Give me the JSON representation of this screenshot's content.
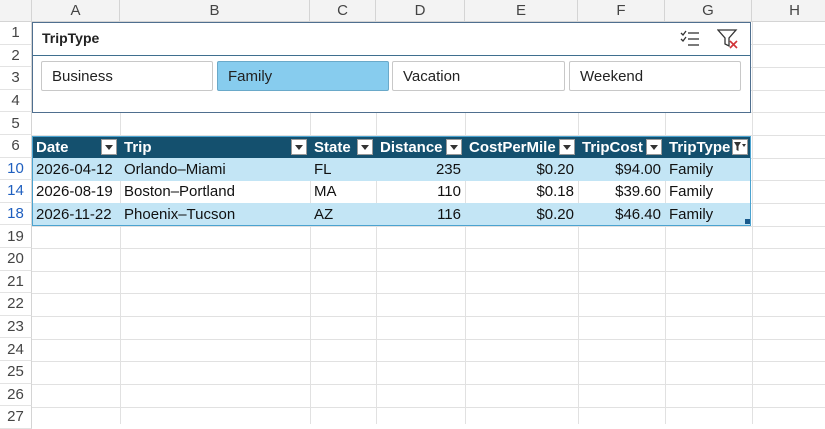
{
  "columns": [
    "A",
    "B",
    "C",
    "D",
    "E",
    "F",
    "G",
    "H"
  ],
  "rows": [
    "1",
    "2",
    "3",
    "4",
    "5",
    "6",
    "10",
    "14",
    "18",
    "19",
    "20",
    "21",
    "22",
    "23",
    "24",
    "25",
    "26",
    "27"
  ],
  "filtered_rows": [
    "10",
    "14",
    "18"
  ],
  "slicer": {
    "title": "TripType",
    "icons": [
      "multi-select-icon",
      "clear-filter-icon"
    ],
    "buttons": [
      {
        "label": "Business",
        "selected": false
      },
      {
        "label": "Family",
        "selected": true
      },
      {
        "label": "Vacation",
        "selected": false
      },
      {
        "label": "Weekend",
        "selected": false
      }
    ]
  },
  "table": {
    "headers": [
      "Date",
      "Trip",
      "State",
      "Distance",
      "CostPerMile",
      "TripCost",
      "TripType"
    ],
    "filtered_column": "TripType",
    "rows": [
      [
        "2026-04-12",
        "Orlando–Miami",
        "FL",
        "235",
        "$0.20",
        "$94.00",
        "Family"
      ],
      [
        "2026-08-19",
        "Boston–Portland",
        "MA",
        "110",
        "$0.18",
        "$39.60",
        "Family"
      ],
      [
        "2026-11-22",
        "Phoenix–Tucson",
        "AZ",
        "116",
        "$0.20",
        "$46.40",
        "Family"
      ]
    ]
  },
  "colors": {
    "header_bg": "#14506e",
    "band": "#c3e5f5",
    "slicer_selected": "#87ccee",
    "filtered_row_number": "#1f5fbf"
  }
}
